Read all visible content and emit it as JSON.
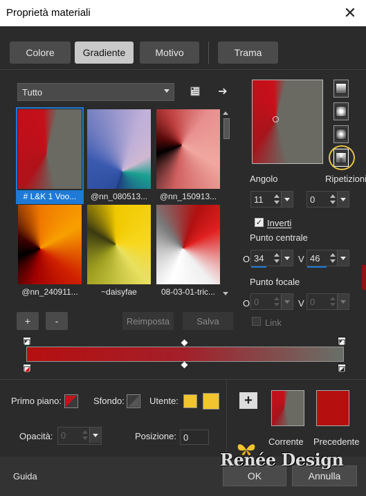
{
  "window": {
    "title": "Proprietà materiali",
    "close_icon": "close-icon"
  },
  "tabs": [
    {
      "label": "Colore",
      "active": false
    },
    {
      "label": "Gradiente",
      "active": true
    },
    {
      "label": "Motivo",
      "active": false
    },
    {
      "label": "Trama",
      "active": false
    }
  ],
  "library": {
    "category_value": "Tutto",
    "items": [
      {
        "label": "# L&K 1 Voo...",
        "selected": true
      },
      {
        "label": "@nn_080513...",
        "selected": false
      },
      {
        "label": "@nn_150913...",
        "selected": false
      },
      {
        "label": "@nn_240911...",
        "selected": false
      },
      {
        "label": "~daisyfae",
        "selected": false
      },
      {
        "label": "08-03-01-tric...",
        "selected": false
      }
    ],
    "add_label": "+",
    "remove_label": "-",
    "reset_label": "Reimposta",
    "save_label": "Salva"
  },
  "gradient": {
    "angle_label": "Angolo",
    "angle_value": "11",
    "repeats_label": "Ripetizioni",
    "repeats_value": "0",
    "invert_label": "Inverti",
    "invert_checked": true,
    "center_label": "Punto centrale",
    "center_o_label": "O",
    "center_o_value": "34",
    "center_v_label": "V",
    "center_v_value": "46",
    "focal_label": "Punto focale",
    "focal_o_label": "O",
    "focal_o_value": "0",
    "focal_v_label": "V",
    "focal_v_value": "0",
    "link_label": "Link",
    "link_checked": false,
    "color_start": "#b50f10",
    "color_end": "#687068"
  },
  "bottom": {
    "foreground_label": "Primo piano:",
    "background_label": "Sfondo:",
    "user_label": "Utente:",
    "user_color": "#f2c52e",
    "opacity_label": "Opacità:",
    "opacity_value": "0",
    "position_label": "Posizione:",
    "position_value": "0",
    "current_label": "Corrente",
    "previous_label": "Precedente",
    "previous_color": "#b50f10"
  },
  "footer": {
    "help_label": "Guida",
    "ok_label": "OK",
    "cancel_label": "Annulla",
    "watermark": "Renée Design"
  }
}
